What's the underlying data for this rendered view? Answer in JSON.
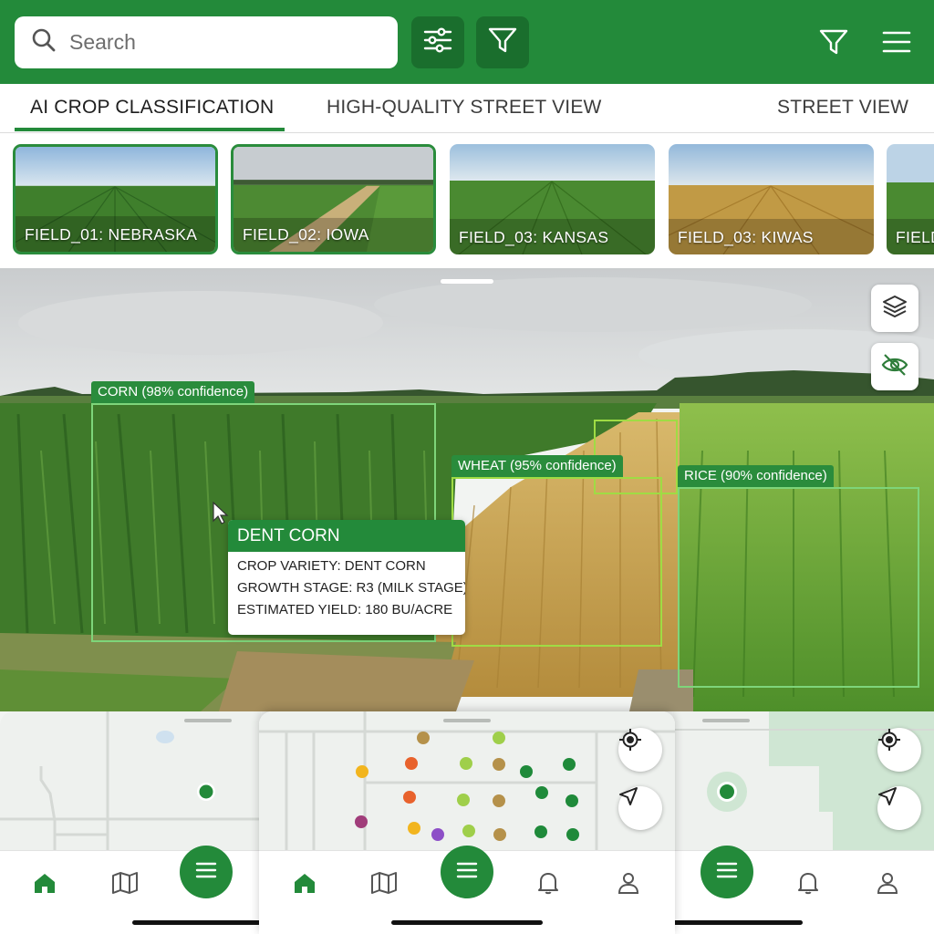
{
  "header": {
    "search_placeholder": "Search",
    "icons": [
      "search-icon",
      "sliders-icon",
      "filter-icon",
      "filter-outline-icon",
      "menu-icon"
    ]
  },
  "tabs": [
    {
      "label": "AI CROP CLASSIFICATION",
      "active": true
    },
    {
      "label": "HIGH-QUALITY STREET VIEW",
      "active": false
    },
    {
      "label": "STREET VIEW",
      "active": false
    }
  ],
  "thumbnails": [
    {
      "label": "FIELD_01: NEBRASKA",
      "selected": true
    },
    {
      "label": "FIELD_02: IOWA",
      "selected": true
    },
    {
      "label": "FIELD_03: KANSAS",
      "selected": false
    },
    {
      "label": "FIELD_03: KIWAS",
      "selected": false
    },
    {
      "label": "FIELD_",
      "selected": false
    }
  ],
  "scene": {
    "icons": [
      "layers-icon",
      "eye-off-icon",
      "cursor-icon"
    ],
    "detections": {
      "corn": "CORN (98% confidence)",
      "wheat": "WHEAT (95% confidence)",
      "rice": "RICE (90% confidence)"
    },
    "popup": {
      "title": "DENT CORN",
      "variety": "CROP VARIETY: DENT CORN",
      "stage": "GROWTH STAGE: R3 (MILK STAGE)",
      "yield": "ESTIMATED YIELD: 180 BU/ACRE"
    }
  },
  "bottom_nav": {
    "icons": [
      "home-icon",
      "map-icon",
      "menu-fab-icon",
      "bell-icon",
      "user-icon",
      "crosshair-icon",
      "navigation-icon"
    ]
  },
  "colors": {
    "brand_green": "#238a3a",
    "brand_green_dark": "#1a6e2d",
    "bbox_green": "#7ed57a",
    "bbox_lime": "#9fdc44"
  }
}
